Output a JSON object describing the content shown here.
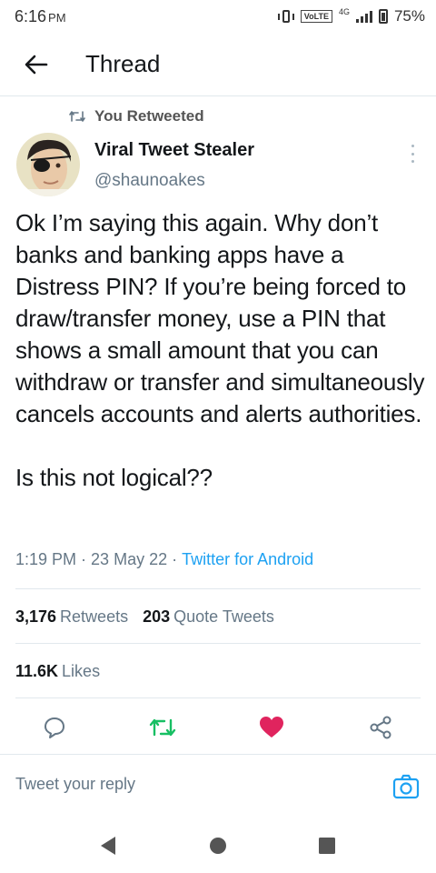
{
  "status_bar": {
    "time": "6:16",
    "ampm": "PM",
    "volte": "VoLTE",
    "network": "4G",
    "battery": "75%",
    "battery_level": 0.75
  },
  "header": {
    "title": "Thread",
    "back_icon": "arrow-left-icon"
  },
  "tweet": {
    "context": "You Retweeted",
    "author_name": "Viral Tweet Stealer",
    "handle": "@shaunoakes",
    "text": "Ok I’m saying this again. Why don’t banks and banking apps have a Distress PIN? If you’re being forced to draw/transfer money, use a PIN that shows a small amount that you can withdraw or transfer and simultaneously cancels accounts and alerts authorities.\n\nIs this not logical??",
    "time": "1:19 PM",
    "date": "23 May 22",
    "separator": "·",
    "client": "Twitter for Android",
    "retweets_count": "3,176",
    "retweets_label": "Retweets",
    "quotes_count": "203",
    "quotes_label": "Quote Tweets",
    "likes_count": "11.6K",
    "likes_label": "Likes"
  },
  "actions": {
    "reply_icon": "reply-icon",
    "retweet_icon": "retweet-icon",
    "like_icon": "heart-icon",
    "share_icon": "share-icon",
    "retweet_active_color": "#17bf63",
    "like_active_color": "#e0245e"
  },
  "reply": {
    "placeholder": "Tweet your reply",
    "camera_icon": "camera-icon"
  },
  "colors": {
    "accent": "#1da1f2",
    "secondary_text": "#657786",
    "divider": "#e1e8ed"
  }
}
